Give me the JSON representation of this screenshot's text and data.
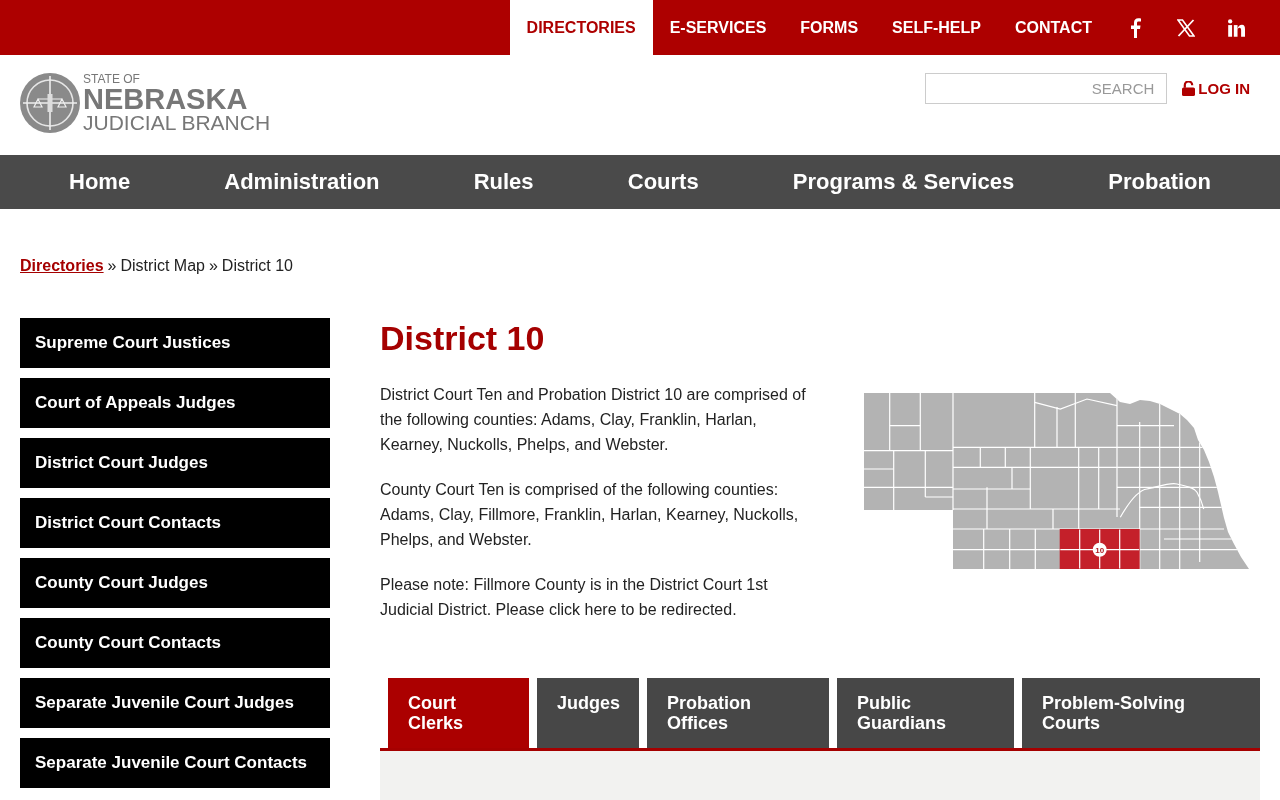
{
  "top_nav": {
    "items": [
      {
        "label": "DIRECTORIES",
        "selected": true
      },
      {
        "label": "E-SERVICES",
        "selected": false
      },
      {
        "label": "FORMS",
        "selected": false
      },
      {
        "label": "SELF-HELP",
        "selected": false
      },
      {
        "label": "CONTACT",
        "selected": false
      }
    ]
  },
  "header": {
    "logo": {
      "line_1": "STATE OF",
      "line_2": "NEBRASKA",
      "line_3": "JUDICIAL BRANCH"
    },
    "search": {
      "placeholder": "SEARCH"
    },
    "login": "LOG IN"
  },
  "main_nav": {
    "items": [
      "Home",
      "Administration",
      "Rules",
      "Courts",
      "Programs & Services",
      "Probation"
    ]
  },
  "breadcrumb": {
    "separator": "»",
    "items": [
      {
        "label": "Directories",
        "kind": "link"
      },
      {
        "label": "District Map",
        "kind": "text"
      },
      {
        "label": "District 10",
        "kind": "text"
      }
    ]
  },
  "sidebar": {
    "items": [
      "Supreme Court Justices",
      "Court of Appeals Judges",
      "District Court Judges",
      "District Court Contacts",
      "County Court Judges",
      "County Court Contacts",
      "Separate Juvenile Court Judges",
      "Separate Juvenile Court Contacts"
    ]
  },
  "content": {
    "title": "District 10",
    "paragraphs": [
      "District Court Ten and Probation District 10 are comprised of the following counties: Adams, Clay, Franklin, Harlan, Kearney, Nuckolls, Phelps, and Webster.",
      "County Court Ten is comprised of the following counties: Adams, Clay, Fillmore, Franklin, Harlan, Kearney, Nuckolls, Phelps, and Webster.",
      "Please note: Fillmore County is in the District Court 1st Judicial District. Please click here to be redirected."
    ],
    "map": {
      "district_label": "10"
    }
  },
  "tabs": [
    {
      "label": "Court Clerks",
      "selected": true
    },
    {
      "label": "Judges",
      "selected": false
    },
    {
      "label": "Probation Offices",
      "selected": false
    },
    {
      "label": "Public Guardians",
      "selected": false
    },
    {
      "label": "Problem-Solving Courts",
      "selected": false
    }
  ]
}
